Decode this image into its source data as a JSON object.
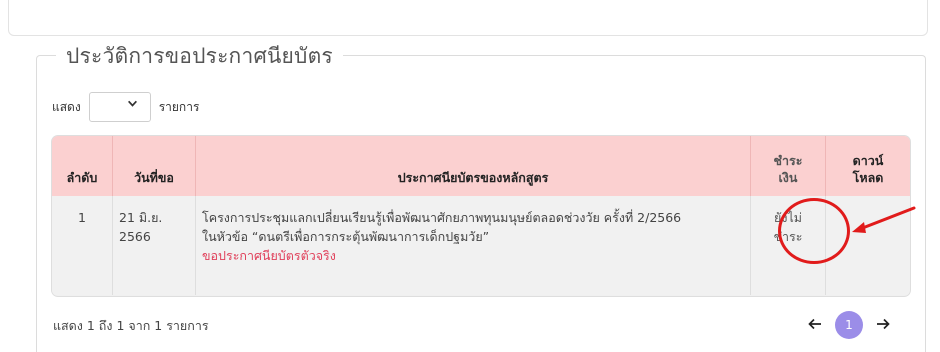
{
  "section": {
    "title": "ประวัติการขอประกาศนียบัตร"
  },
  "length_control": {
    "prefix": "แสดง",
    "selected": "",
    "suffix": "รายการ"
  },
  "table": {
    "headers": {
      "index": "ลำดับ",
      "date": "วันที่ขอ",
      "certificate": "ประกาศนียบัตรของหลักสูตร",
      "payment_line1": "ชำระ",
      "payment_line2": "เงิน",
      "download_line1": "ดาวน์",
      "download_line2": "โหลด"
    },
    "rows": [
      {
        "index": "1",
        "date_line1": "21 มิ.ย.",
        "date_line2": "2566",
        "course_line1": "โครงการประชุมแลกเปลี่ยนเรียนรู้เพื่อพัฒนาศักยภาพทุนมนุษย์ตลอดช่วงวัย ครั้งที่ 2/2566",
        "course_line2": "ในหัวข้อ “ดนตรีเพื่อการกระตุ้นพัฒนาการเด็กปฐมวัย”",
        "request_link": "ขอประกาศนียบัตรตัวจริง",
        "payment_line1": "ยังไม่",
        "payment_line2": "ชำระ",
        "download": ""
      }
    ]
  },
  "info_text": "แสดง 1 ถึง 1 จาก 1 รายการ",
  "pagination": {
    "prev_icon": "arrow-left-icon",
    "current_page": "1",
    "next_icon": "arrow-right-icon"
  },
  "colors": {
    "header_bg": "#fbd0d0",
    "link": "#e0405a",
    "page_active": "#9b8de8",
    "annotation": "#e11b1b"
  }
}
